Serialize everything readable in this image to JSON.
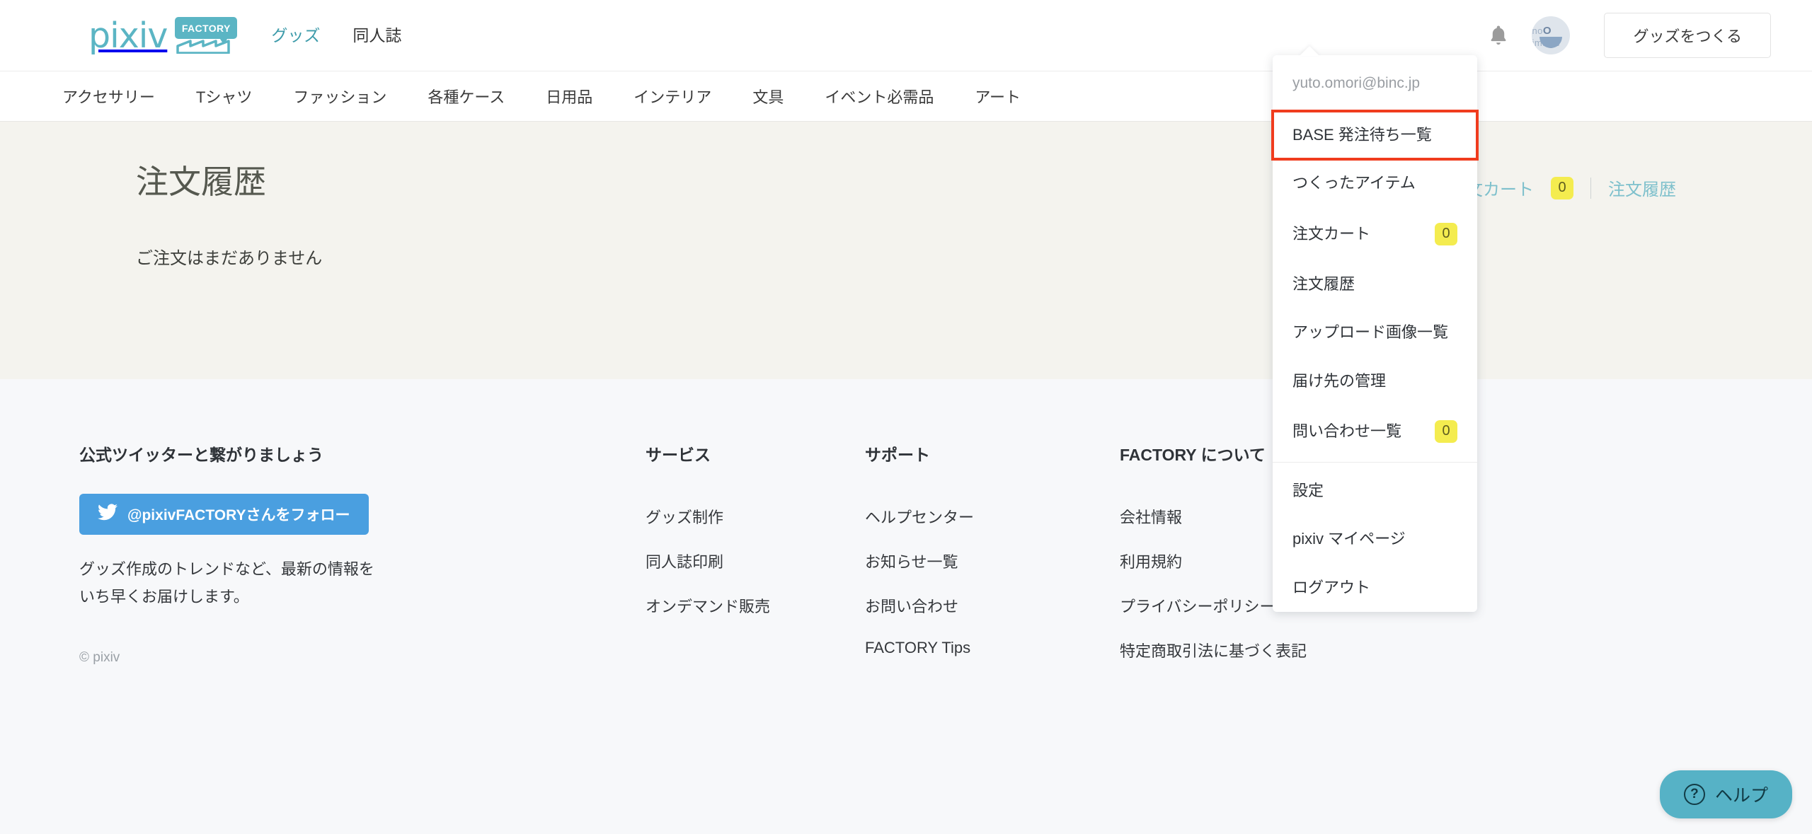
{
  "header": {
    "logo_text": "pixiv",
    "logo_badge": "FACTORY",
    "nav": [
      {
        "label": "グッズ",
        "active": true
      },
      {
        "label": "同人誌",
        "active": false
      }
    ],
    "notifications_icon": "bell-icon",
    "avatar_icon": "avatar-no-image",
    "avatar_placeholder_text": "no image",
    "make_button": "グッズをつくる"
  },
  "category_nav": [
    "アクセサリー",
    "Tシャツ",
    "ファッション",
    "各種ケース",
    "日用品",
    "インテリア",
    "文具",
    "イベント必需品",
    "アート"
  ],
  "main": {
    "title": "注文履歴",
    "empty_message": "ご注文はまだありません",
    "links": {
      "cart_label": "注文カート",
      "cart_count": "0",
      "order_history_label": "注文履歴"
    }
  },
  "dropdown": {
    "email": "yuto.omori@binc.jp",
    "items": [
      {
        "label": "BASE 発注待ち一覧",
        "badge": null,
        "highlighted": true
      },
      {
        "label": "つくったアイテム",
        "badge": null,
        "highlighted": false
      },
      {
        "label": "注文カート",
        "badge": "0",
        "highlighted": false
      },
      {
        "label": "注文履歴",
        "badge": null,
        "highlighted": false
      },
      {
        "label": "アップロード画像一覧",
        "badge": null,
        "highlighted": false
      },
      {
        "label": "届け先の管理",
        "badge": null,
        "highlighted": false
      },
      {
        "label": "問い合わせ一覧",
        "badge": "0",
        "highlighted": false
      }
    ],
    "items_lower": [
      {
        "label": "設定"
      },
      {
        "label": "pixiv マイページ"
      },
      {
        "label": "ログアウト"
      }
    ]
  },
  "footer": {
    "twitter": {
      "heading": "公式ツイッターと繋がりましょう",
      "button_label": "@pixivFACTORYさんをフォロー",
      "icon": "twitter-bird-icon",
      "description_line1": "グッズ作成のトレンドなど、最新の情報を",
      "description_line2": "いち早くお届けします。"
    },
    "copyright": "© pixiv",
    "columns": [
      {
        "heading": "サービス",
        "links": [
          "グッズ制作",
          "同人誌印刷",
          "オンデマンド販売"
        ]
      },
      {
        "heading": "サポート",
        "links": [
          "ヘルプセンター",
          "お知らせ一覧",
          "お問い合わせ",
          "FACTORY Tips"
        ]
      },
      {
        "heading": "FACTORY について",
        "links": [
          "会社情報",
          "利用規約",
          "プライバシーポリシー",
          "特定商取引法に基づく表記"
        ]
      }
    ]
  },
  "help_button": {
    "label": "ヘルプ",
    "icon": "question-circle-icon"
  },
  "colors": {
    "brand_teal": "#5BB5C4",
    "link_teal": "#7EC0CC",
    "badge_yellow": "#F4EC4F",
    "highlight_red": "#F03C1E",
    "twitter_blue": "#4A9FE0",
    "main_bg": "#F4F3EE",
    "footer_bg": "#F7F8FA"
  }
}
